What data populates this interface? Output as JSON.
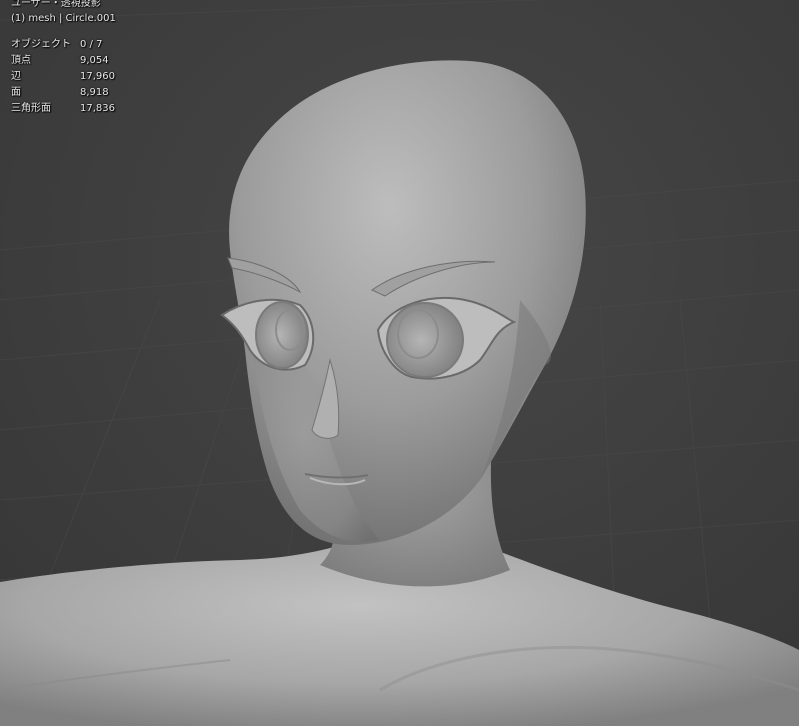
{
  "viewport": {
    "view_title": "ユーザー・透視投影",
    "object_name": "(1) mesh | Circle.001"
  },
  "stats": [
    {
      "label": "オブジェクト",
      "value": "0 / 7"
    },
    {
      "label": "頂点",
      "value": "9,054"
    },
    {
      "label": "辺",
      "value": "17,960"
    },
    {
      "label": "面",
      "value": "8,918"
    },
    {
      "label": "三角形面",
      "value": "17,836"
    }
  ],
  "colors": {
    "background": "#3d3d3d",
    "grid_line": "#4a4a4a",
    "mesh_base": "#9a9a9a",
    "overlay_text": "#e6e6e6"
  }
}
